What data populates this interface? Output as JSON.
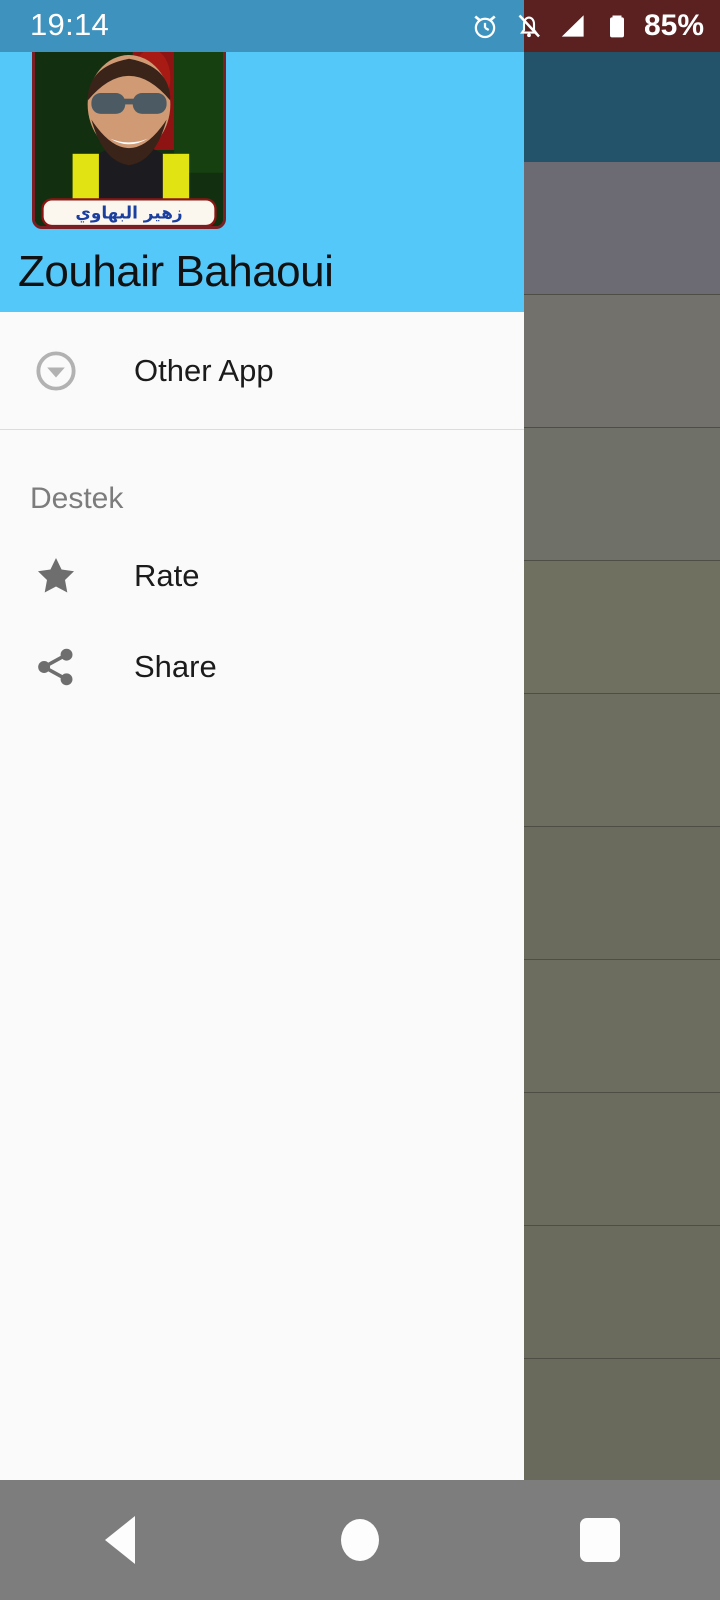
{
  "status_bar": {
    "time": "19:14",
    "battery_percent": "85%",
    "icons": [
      "alarm-icon",
      "notifications-off-icon",
      "signal-icon",
      "battery-icon"
    ],
    "drawer_bg_color": "#3d92be",
    "app_bg_color": "#5b2020"
  },
  "drawer": {
    "header": {
      "title": "Zouhair Bahaoui",
      "avatar_caption": "زهير البهاوي",
      "background_color": "#55c8fa",
      "avatar_name": "app-logo"
    },
    "items": [
      {
        "label": "Other App",
        "icon": "arrow-drop-down-circle-icon"
      }
    ],
    "section": {
      "title": "Destek",
      "items": [
        {
          "label": "Rate",
          "icon": "star-icon"
        },
        {
          "label": "Share",
          "icon": "share-icon"
        }
      ]
    },
    "background_color": "#fafafa"
  },
  "background_app": {
    "appbar_color": "#23536a",
    "scrim_color": "#7b7b6f",
    "rows": [
      {
        "tint": "#6c6b74"
      },
      {
        "tint": "#72716c"
      },
      {
        "tint": "#6f7068"
      },
      {
        "tint": "#6f705f"
      },
      {
        "tint": "#6d6e5f"
      },
      {
        "tint": "#6a6b5d"
      },
      {
        "tint": "#6c6d5f"
      },
      {
        "tint": "#6b6c5e"
      },
      {
        "tint": "#6a6b5d"
      },
      {
        "tint": "#696a5c"
      }
    ]
  },
  "nav_bar": {
    "background_color": "#7d7d7d",
    "buttons": [
      {
        "name": "back-button",
        "icon": "triangle-left-icon"
      },
      {
        "name": "home-button",
        "icon": "circle-icon"
      },
      {
        "name": "recents-button",
        "icon": "square-icon"
      }
    ]
  }
}
